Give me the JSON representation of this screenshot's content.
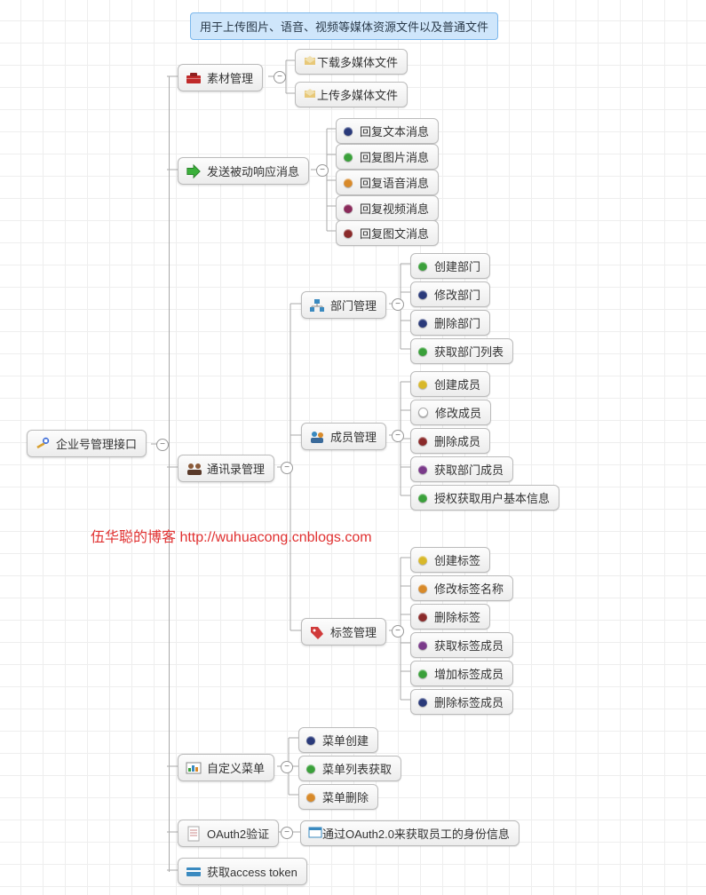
{
  "tooltip": "用于上传图片、语音、视频等媒体资源文件以及普通文件",
  "root": "企业号管理接口",
  "watermark": "伍华聪的博客 http://wuhuacong.cnblogs.com",
  "lv1": {
    "sucai": "素材管理",
    "fasong": "发送被动响应消息",
    "tongxun": "通讯录管理",
    "caidan": "自定义菜单",
    "oauth": "OAuth2验证",
    "token": "获取access token"
  },
  "lv2": {
    "bumen": "部门管理",
    "chengyuan": "成员管理",
    "biaoqian": "标签管理",
    "oauth_desc": "通过OAuth2.0来获取员工的身份信息"
  },
  "sucai_children": [
    "下载多媒体文件",
    "上传多媒体文件"
  ],
  "fasong_children": [
    "回复文本消息",
    "回复图片消息",
    "回复语音消息",
    "回复视频消息",
    "回复图文消息"
  ],
  "bumen_children": [
    "创建部门",
    "修改部门",
    "删除部门",
    "获取部门列表"
  ],
  "chengyuan_children": [
    "创建成员",
    "修改成员",
    "删除成员",
    "获取部门成员",
    "授权获取用户基本信息"
  ],
  "biaoqian_children": [
    "创建标签",
    "修改标签名称",
    "删除标签",
    "获取标签成员",
    "增加标签成员",
    "删除标签成员"
  ],
  "caidan_children": [
    "菜单创建",
    "菜单列表获取",
    "菜单删除"
  ],
  "dot_colors": {
    "navy": "#2a3a7a",
    "green": "#3aa03a",
    "orange": "#d88a2a",
    "darkred": "#8a2a2a",
    "purple": "#7a3a8a",
    "yellow": "#d8b82a",
    "hollow": "#fff",
    "red": "#c02a2a"
  }
}
